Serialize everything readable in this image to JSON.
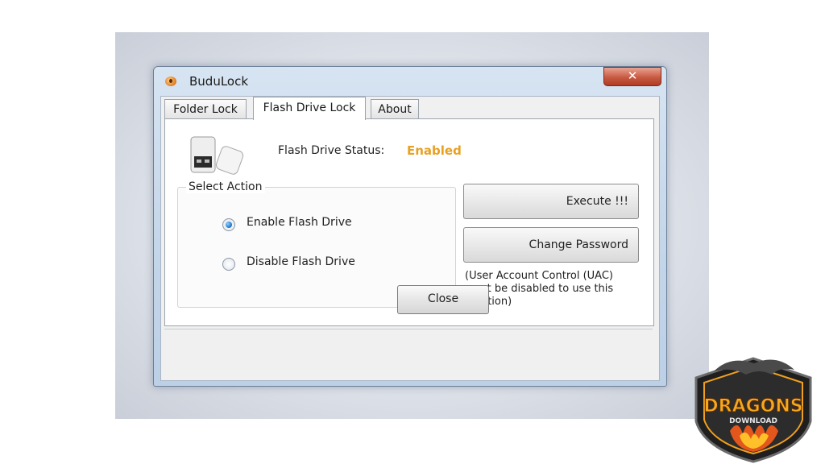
{
  "window": {
    "title": "BuduLock",
    "close_glyph": "✕"
  },
  "tabs": [
    {
      "label": "Folder Lock",
      "active": false
    },
    {
      "label": "Flash Drive Lock",
      "active": true
    },
    {
      "label": "About",
      "active": false
    }
  ],
  "status": {
    "label": "Flash Drive Status:",
    "value": "Enabled",
    "value_color": "#e8a020"
  },
  "select_action": {
    "label": "Select Action",
    "options": [
      {
        "label": "Enable Flash Drive",
        "checked": true
      },
      {
        "label": "Disable Flash Drive",
        "checked": false
      }
    ]
  },
  "buttons": {
    "execute": "Execute !!!",
    "change_password": "Change Password",
    "close": "Close"
  },
  "uac_note": "(User Account Control (UAC) must be disabled to use this function)",
  "watermark": {
    "text": "DRAGONS",
    "subtext": "DOWNLOAD"
  }
}
